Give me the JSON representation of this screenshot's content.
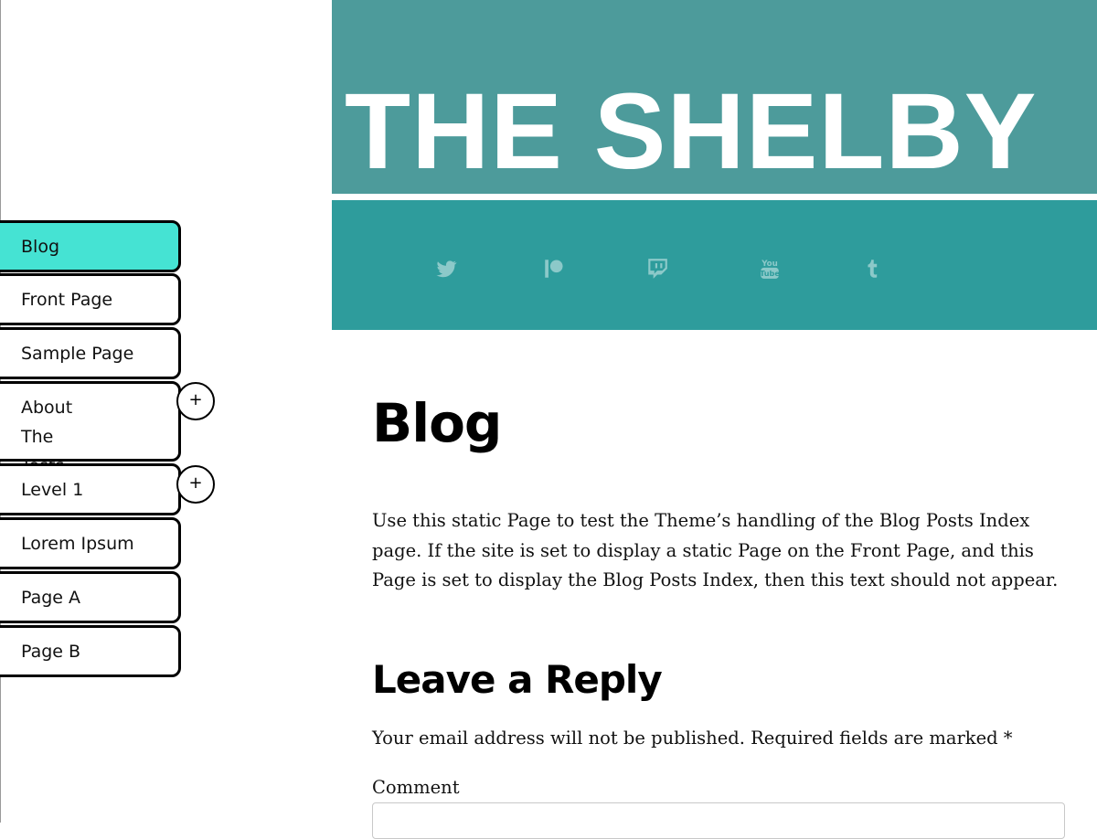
{
  "nav": {
    "items": [
      {
        "label": "Blog",
        "active": true
      },
      {
        "label": "Front Page"
      },
      {
        "label": "Sample Page"
      },
      {
        "label": "About The Tests",
        "expandable": true
      },
      {
        "label": "Level 1",
        "expandable": true
      },
      {
        "label": "Lorem Ipsum"
      },
      {
        "label": "Page A"
      },
      {
        "label": "Page B"
      }
    ],
    "expand_symbol": "+"
  },
  "header": {
    "site_title": "THE SHELBY",
    "social_icons": [
      "twitter-icon",
      "patreon-icon",
      "twitch-icon",
      "youtube-icon",
      "tumblr-icon"
    ],
    "colors": {
      "top": "#4d9b9b",
      "bottom": "#2e9c9c",
      "icon": "#8cc9c9"
    }
  },
  "main": {
    "title": "Blog",
    "intro": "Use this static Page to test the Theme’s handling of the Blog Posts Index page. If the site is set to display a static Page on the Front Page, and this Page is set to display the Blog Posts Index, then this text should not appear.",
    "reply_title": "Leave a Reply",
    "notes": "Your email address will not be published. Required fields are marked *",
    "comment_label": "Comment",
    "comment_value": ""
  },
  "colors": {
    "active_nav": "#45e3d3"
  }
}
